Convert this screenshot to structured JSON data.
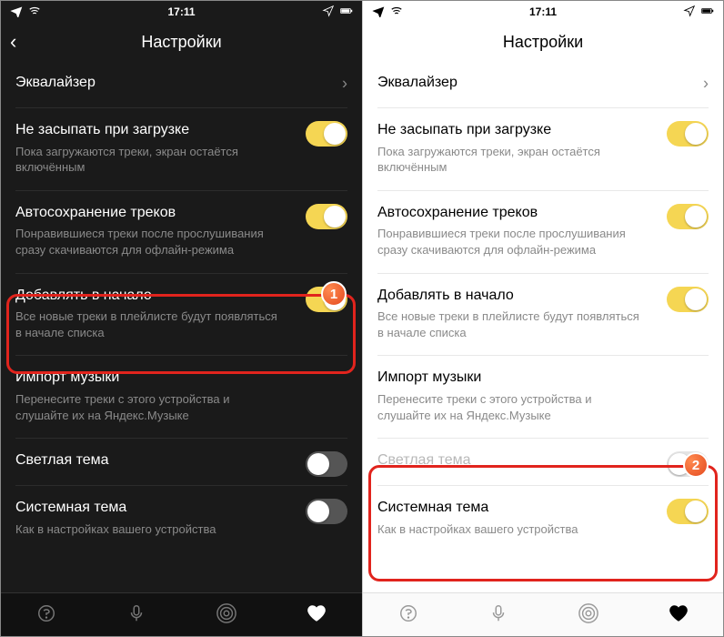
{
  "statusbar": {
    "time": "17:11"
  },
  "header": {
    "title": "Настройки"
  },
  "rows": {
    "equalizer": {
      "label": "Эквалайзер"
    },
    "nosleep": {
      "label": "Не засыпать при загрузке",
      "sub": "Пока загружаются треки, экран остаётся включённым"
    },
    "autosave": {
      "label": "Автосохранение треков",
      "sub": "Понравившиеся треки после прослушивания сразу скачиваются для офлайн-режима"
    },
    "addtop": {
      "label": "Добавлять в начало",
      "sub": "Все новые треки в плейлисте будут появляться в начале списка"
    },
    "import": {
      "label": "Импорт музыки",
      "sub": "Перенесите треки с этого устройства и слушайте их на Яндекс.Музыке"
    },
    "lighttheme": {
      "label": "Светлая тема"
    },
    "systemtheme": {
      "label": "Системная тема",
      "sub": "Как в настройках вашего устройства"
    }
  },
  "badges": {
    "one": "1",
    "two": "2"
  }
}
